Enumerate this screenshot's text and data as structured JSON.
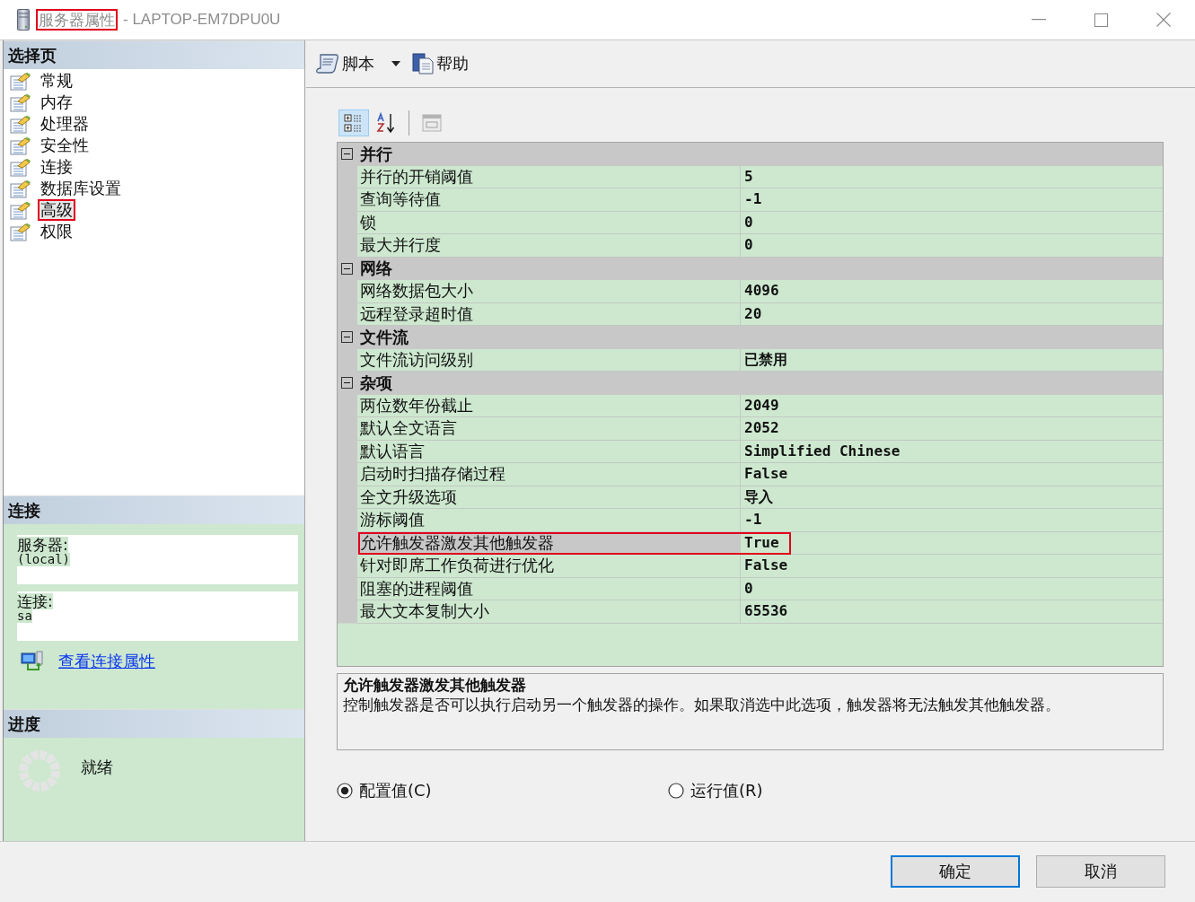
{
  "window": {
    "title": "服务器属性",
    "title_highlighted": true,
    "subtitle": "- LAPTOP-EM7DPU0U"
  },
  "sidebar": {
    "header": "选择页",
    "items": [
      {
        "label": "常规",
        "selected": false,
        "highlighted": false
      },
      {
        "label": "内存",
        "selected": false,
        "highlighted": false
      },
      {
        "label": "处理器",
        "selected": false,
        "highlighted": false
      },
      {
        "label": "安全性",
        "selected": false,
        "highlighted": false
      },
      {
        "label": "连接",
        "selected": false,
        "highlighted": false
      },
      {
        "label": "数据库设置",
        "selected": false,
        "highlighted": false
      },
      {
        "label": "高级",
        "selected": true,
        "highlighted": true
      },
      {
        "label": "权限",
        "selected": false,
        "highlighted": false
      }
    ]
  },
  "connection": {
    "header": "连接",
    "fields": [
      {
        "label": "服务器:",
        "value": "(local)"
      },
      {
        "label": "连接:",
        "value": "sa"
      }
    ],
    "link": "查看连接属性"
  },
  "progress": {
    "header": "进度",
    "status": "就绪"
  },
  "toolbar": [
    {
      "kind": "script",
      "label": "脚本",
      "dropdown": true
    },
    {
      "kind": "help",
      "label": "帮助",
      "dropdown": false
    }
  ],
  "grid_tools": [
    {
      "kind": "categorized",
      "selected": true,
      "disabled": false
    },
    {
      "kind": "alphabetical",
      "selected": false,
      "disabled": false
    },
    {
      "kind": "property_pages",
      "selected": false,
      "disabled": true
    }
  ],
  "categories": [
    {
      "name": "并行",
      "expanded": true,
      "rows": [
        {
          "name": "并行的开销阈值",
          "value": "5",
          "selected": false,
          "highlighted": false
        },
        {
          "name": "查询等待值",
          "value": "-1",
          "selected": false,
          "highlighted": false
        },
        {
          "name": "锁",
          "value": "0",
          "selected": false,
          "highlighted": false
        },
        {
          "name": "最大并行度",
          "value": "0",
          "selected": false,
          "highlighted": false
        }
      ]
    },
    {
      "name": "网络",
      "expanded": true,
      "rows": [
        {
          "name": "网络数据包大小",
          "value": "4096",
          "selected": false,
          "highlighted": false
        },
        {
          "name": "远程登录超时值",
          "value": "20",
          "selected": false,
          "highlighted": false
        }
      ]
    },
    {
      "name": "文件流",
      "expanded": true,
      "rows": [
        {
          "name": "文件流访问级别",
          "value": "已禁用",
          "selected": false,
          "highlighted": false
        }
      ]
    },
    {
      "name": "杂项",
      "expanded": true,
      "rows": [
        {
          "name": "两位数年份截止",
          "value": "2049",
          "selected": false,
          "highlighted": false
        },
        {
          "name": "默认全文语言",
          "value": "2052",
          "selected": false,
          "highlighted": false
        },
        {
          "name": "默认语言",
          "value": "Simplified Chinese",
          "selected": false,
          "highlighted": false
        },
        {
          "name": "启动时扫描存储过程",
          "value": "False",
          "selected": false,
          "highlighted": false
        },
        {
          "name": "全文升级选项",
          "value": "导入",
          "selected": false,
          "highlighted": false
        },
        {
          "name": "游标阈值",
          "value": "-1",
          "selected": false,
          "highlighted": false
        },
        {
          "name": "允许触发器激发其他触发器",
          "value": "True",
          "selected": true,
          "highlighted": true
        },
        {
          "name": "针对即席工作负荷进行优化",
          "value": "False",
          "selected": false,
          "highlighted": false
        },
        {
          "name": "阻塞的进程阈值",
          "value": "0",
          "selected": false,
          "highlighted": false
        },
        {
          "name": "最大文本复制大小",
          "value": "65536",
          "selected": false,
          "highlighted": false
        }
      ]
    }
  ],
  "description": {
    "title": "允许触发器激发其他触发器",
    "text": "控制触发器是否可以执行启动另一个触发器的操作。如果取消选中此选项，触发器将无法触发其他触发器。"
  },
  "radios": [
    {
      "label": "配置值(C)",
      "selected": true
    },
    {
      "label": "运行值(R)",
      "selected": false
    }
  ],
  "buttons": [
    {
      "label": "确定",
      "default": true
    },
    {
      "label": "取消",
      "default": false
    }
  ]
}
